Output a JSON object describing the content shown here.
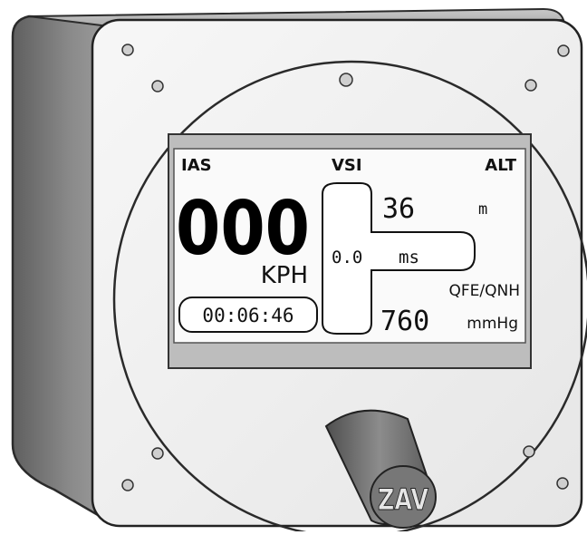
{
  "instrument": {
    "labels": {
      "ias": "IAS",
      "vsi": "VSI",
      "alt": "ALT"
    },
    "airspeed": {
      "value": "000",
      "unit": "KPH"
    },
    "timer": "00:06:46",
    "vertical_speed": {
      "value": "0.0",
      "unit": "ms"
    },
    "altitude": {
      "value": "36",
      "unit": "m"
    },
    "pressure": {
      "mode": "QFE/QNH",
      "value": "760",
      "unit": "mmHg"
    },
    "knob_logo": "ZAV"
  },
  "colors": {
    "housing_side": "#7a7a7a",
    "faceplate": "#f0f0f0",
    "outline": "#222222",
    "screen_bezel": "#bdbdbd",
    "screen": "#fafafa",
    "knob": "#6e6e6e"
  }
}
